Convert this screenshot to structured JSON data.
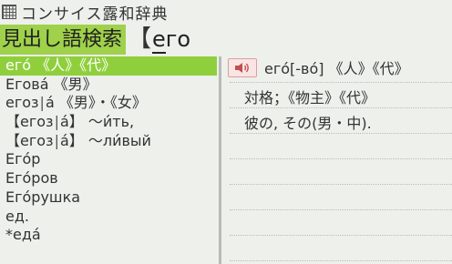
{
  "title": "コンサイス露和辞典",
  "search": {
    "label": "見出し語検索",
    "bracket": "【",
    "query_underlined": "е",
    "query_rest": "го"
  },
  "entries": [
    {
      "text": "его́ 《人》《代》",
      "selected": true
    },
    {
      "text": "Егова́ 《男》",
      "selected": false
    },
    {
      "text": "егоз",
      "pipe": true,
      "suffix": "а́ 《男》・《女》",
      "selected": false
    },
    {
      "text": "【егоз",
      "pipe": true,
      "suffix": "а́】 ～и́ть,",
      "selected": false
    },
    {
      "text": "【егоз",
      "pipe": true,
      "suffix": "а́】 ～ли́вый",
      "selected": false
    },
    {
      "text": "Его́р",
      "selected": false
    },
    {
      "text": "Его́ров",
      "selected": false
    },
    {
      "text": "Его́рушка",
      "selected": false
    },
    {
      "text": "ед.",
      "selected": false
    },
    {
      "text": "*еда́",
      "selected": false
    }
  ],
  "definition": {
    "sound_icon": "speaker-icon",
    "headword": "его́[-во́] 《人》《代》",
    "lines": [
      "対格；《物主》《代》",
      "彼の, その(男・中)."
    ]
  },
  "colors": {
    "accent": "#9fd14a",
    "selected_bg": "#8fcf3c",
    "background": "#eef0ec",
    "sound_bg": "#fbe4e4"
  }
}
